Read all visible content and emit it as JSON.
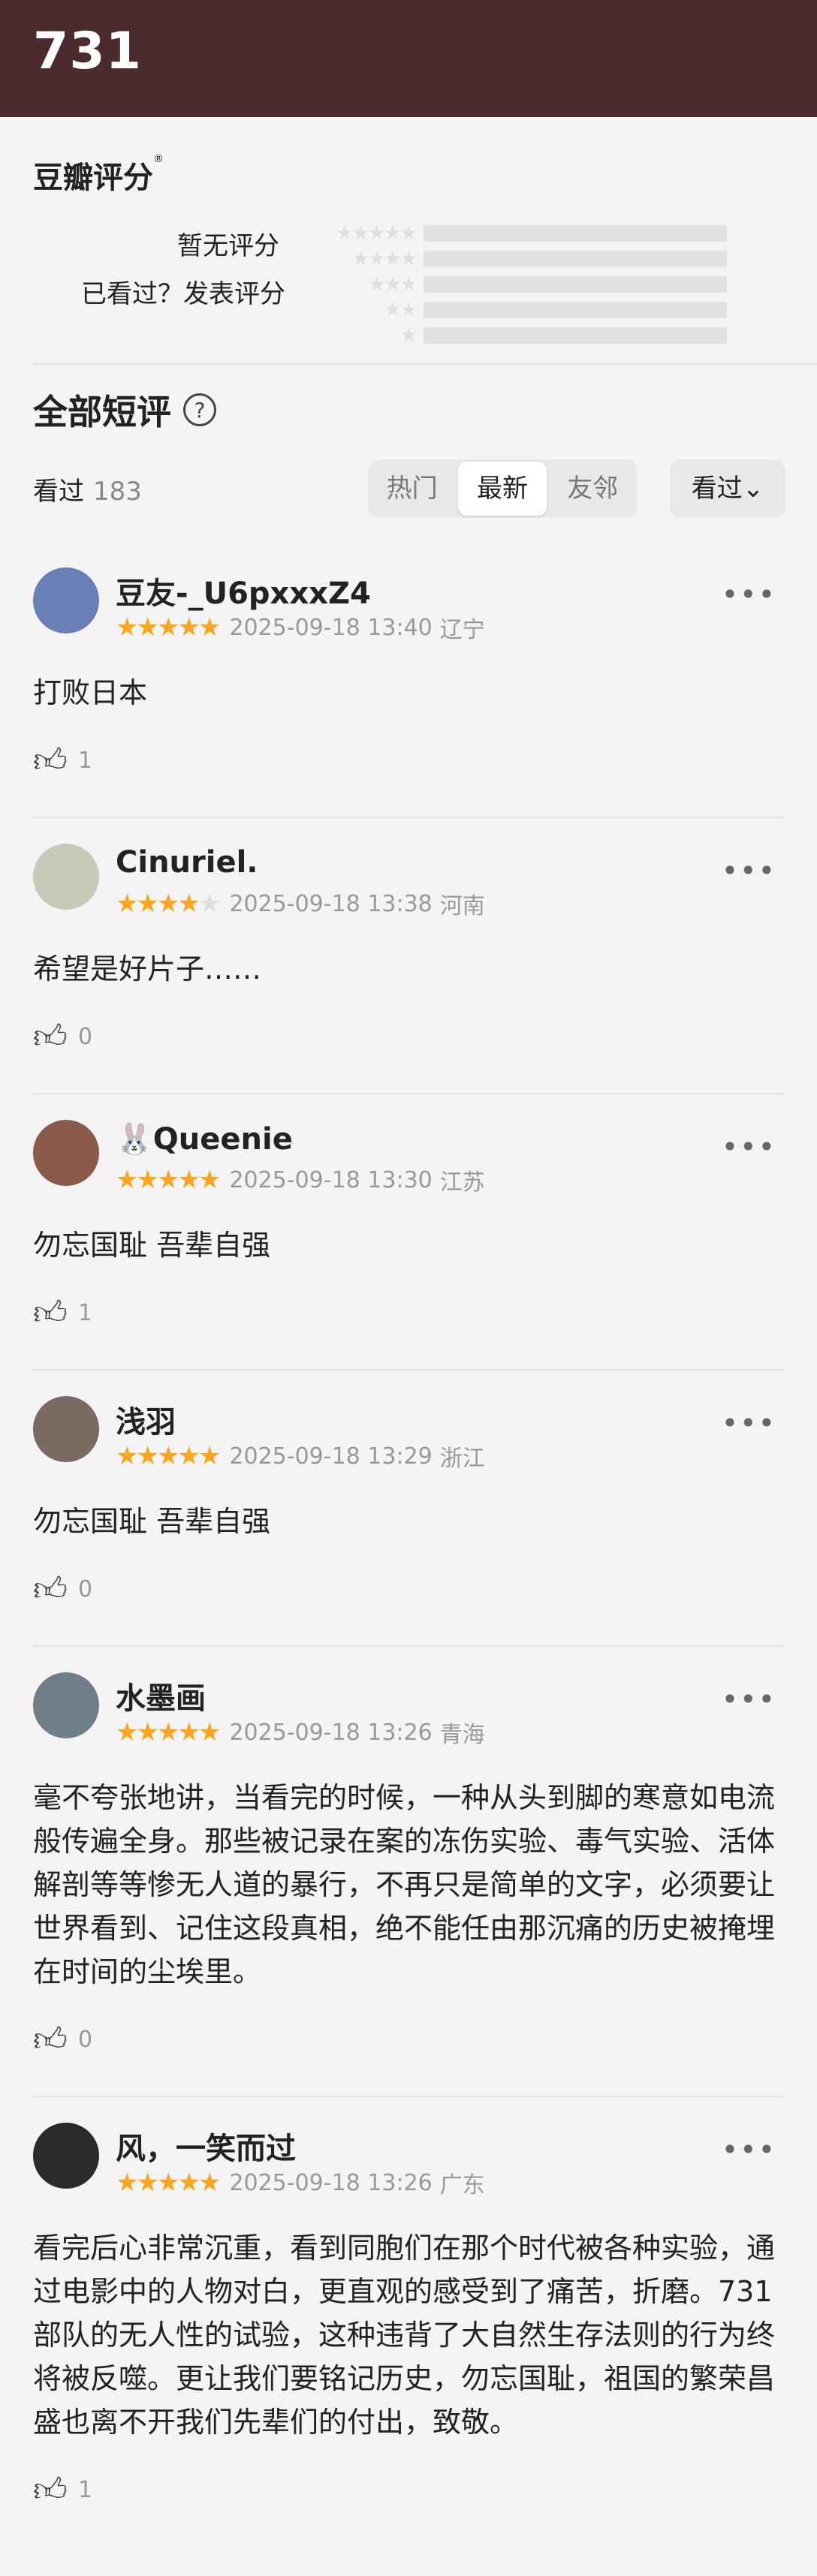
{
  "header": {
    "title": "731"
  },
  "rating": {
    "title": "豆瓣评分",
    "mark": "®",
    "no_rating": "暂无评分",
    "seen_rate": "已看过？发表评分"
  },
  "short": {
    "title": "全部短评",
    "help": "?"
  },
  "filter": {
    "seen_label": "看过",
    "seen_count": "183",
    "tabs": [
      "热门",
      "最新",
      "友邻"
    ],
    "active_tab": "最新",
    "sort_label": "看过"
  },
  "comments": [
    {
      "name": "豆友-_U6pxxxZ4",
      "stars": 5,
      "time": "2025-09-18 13:40",
      "region": "辽宁",
      "text": "打败日本",
      "likes": "1",
      "avatar_color": "#6a7fb5"
    },
    {
      "name": "Cinuriel.",
      "stars": 4,
      "time": "2025-09-18 13:38",
      "region": "河南",
      "text": "希望是好片子……",
      "likes": "0",
      "avatar_color": "#c9c9b8"
    },
    {
      "name": "🐰Queenie",
      "stars": 5,
      "time": "2025-09-18 13:30",
      "region": "江苏",
      "text": "勿忘国耻 吾辈自强",
      "likes": "1",
      "avatar_color": "#8a5a4a"
    },
    {
      "name": "浅羽",
      "stars": 5,
      "time": "2025-09-18 13:29",
      "region": "浙江",
      "text": "勿忘国耻 吾辈自强",
      "likes": "0",
      "avatar_color": "#7a6a62"
    },
    {
      "name": "水墨画",
      "stars": 5,
      "time": "2025-09-18 13:26",
      "region": "青海",
      "text": "毫不夸张地讲，当看完的时候，一种从头到脚的寒意如电流般传遍全身。那些被记录在案的冻伤实验、毒气实验、活体解剖等等惨无人道的暴行，不再只是简单的文字，必须要让世界看到、记住这段真相，绝不能任由那沉痛的历史被掩埋在时间的尘埃里。",
      "likes": "0",
      "avatar_color": "#6f7f8a"
    },
    {
      "name": "风，一笑而过",
      "stars": 5,
      "time": "2025-09-18 13:26",
      "region": "广东",
      "text": "看完后心非常沉重，看到同胞们在那个时代被各种实验，通过电影中的人物对白，更直观的感受到了痛苦，折磨。731部队的无人性的试验，这种违背了大自然生存法则的行为终将被反噬。更让我们要铭记历史，勿忘国耻，祖国的繁荣昌盛也离不开我们先辈们的付出，致敬。",
      "likes": "1",
      "avatar_color": "#2a2a2a"
    }
  ]
}
